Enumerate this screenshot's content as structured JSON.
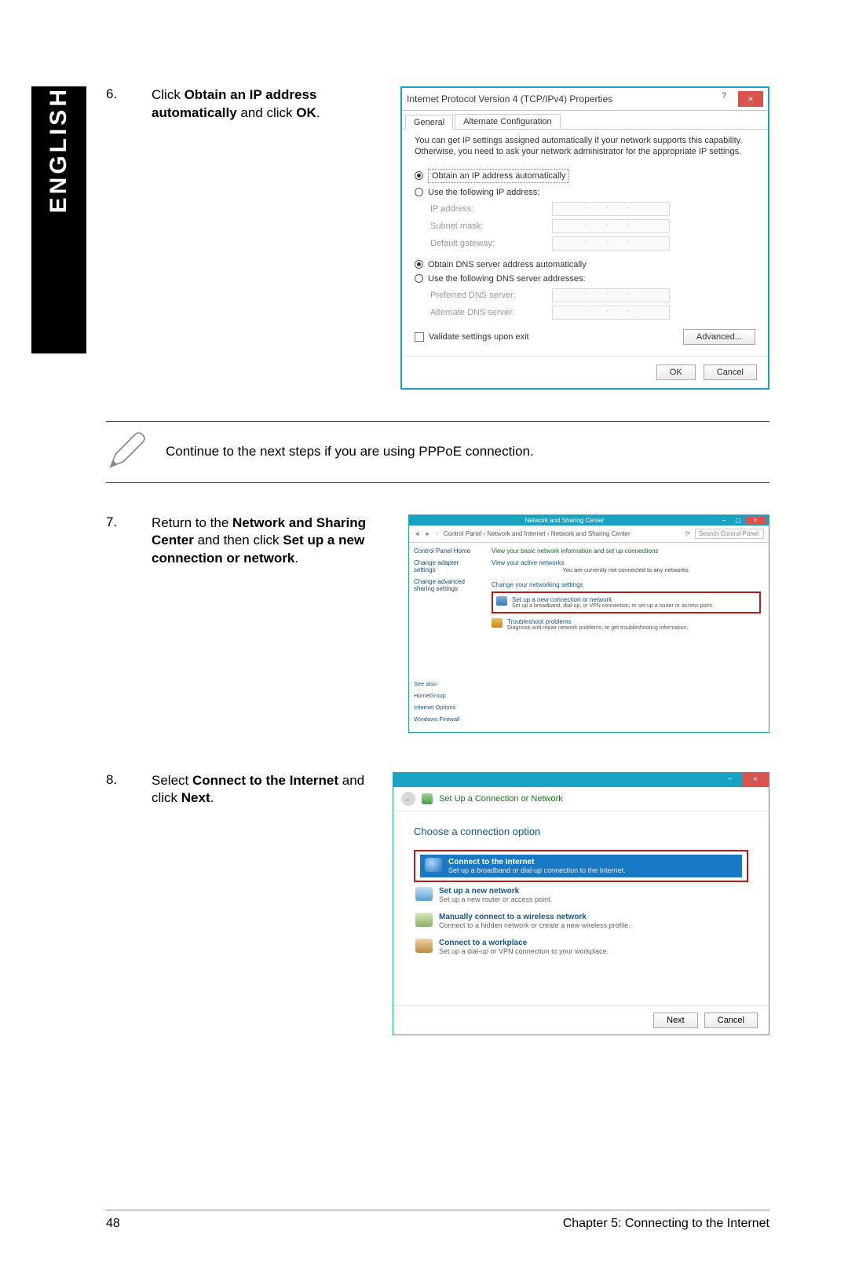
{
  "language_tab": "ENGLISH",
  "step6": {
    "num": "6.",
    "text_parts": [
      "Click ",
      "Obtain an IP address automatically",
      " and click ",
      "OK",
      "."
    ]
  },
  "dialog1": {
    "title": "Internet Protocol Version 4 (TCP/IPv4) Properties",
    "help": "?",
    "close": "×",
    "tab_general": "General",
    "tab_alt": "Alternate Configuration",
    "info": "You can get IP settings assigned automatically if your network supports this capability. Otherwise, you need to ask your network administrator for the appropriate IP settings.",
    "opt_auto_ip": "Obtain an IP address automatically",
    "opt_use_ip": "Use the following IP address:",
    "lbl_ip": "IP address:",
    "lbl_mask": "Subnet mask:",
    "lbl_gw": "Default gateway:",
    "opt_auto_dns": "Obtain DNS server address automatically",
    "opt_use_dns": "Use the following DNS server addresses:",
    "lbl_pref": "Preferred DNS server:",
    "lbl_alt": "Alternate DNS server:",
    "chk_validate": "Validate settings upon exit",
    "btn_adv": "Advanced...",
    "btn_ok": "OK",
    "btn_cancel": "Cancel",
    "ip_dots": "·   ·   ·"
  },
  "note": "Continue to the next steps if you are using PPPoE connection.",
  "step7": {
    "num": "7.",
    "text_parts": [
      "Return to the ",
      "Network and Sharing Center",
      " and then click ",
      "Set up a new connection or network",
      "."
    ]
  },
  "dialog2": {
    "title": "Network and Sharing Center",
    "close": "×",
    "breadcrumb": "Control Panel  ›  Network and Internet  ›  Network and Sharing Center",
    "search_placeholder": "Search Control Panel",
    "side_home": "Control Panel Home",
    "side_adapter": "Change adapter settings",
    "side_sharing": "Change advanced sharing settings",
    "main_head": "View your basic network information and set up connections",
    "main_active": "View your active networks",
    "main_active_note": "You are currently not connected to any networks.",
    "main_change": "Change your networking settings",
    "task1_title": "Set up a new connection or network",
    "task1_sub": "Set up a broadband, dial-up, or VPN connection; or set up a router or access point.",
    "task2_title": "Troubleshoot problems",
    "task2_sub": "Diagnose and repair network problems, or get troubleshooting information.",
    "seealso": "See also",
    "seealso1": "HomeGroup",
    "seealso2": "Internet Options",
    "seealso3": "Windows Firewall"
  },
  "step8": {
    "num": "8.",
    "text_parts": [
      "Select ",
      "Connect to the Internet",
      " and click ",
      "Next",
      "."
    ]
  },
  "dialog3": {
    "min": "−",
    "close": "×",
    "subtitle": "Set Up a Connection or Network",
    "choose": "Choose a connection option",
    "opt1_title": "Connect to the Internet",
    "opt1_sub": "Set up a broadband or dial-up connection to the Internet.",
    "opt2_title": "Set up a new network",
    "opt2_sub": "Set up a new router or access point.",
    "opt3_title": "Manually connect to a wireless network",
    "opt3_sub": "Connect to a hidden network or create a new wireless profile.",
    "opt4_title": "Connect to a workplace",
    "opt4_sub": "Set up a dial-up or VPN connection to your workplace.",
    "btn_next": "Next",
    "btn_cancel": "Cancel"
  },
  "footer": {
    "page": "48",
    "chapter": "Chapter 5: Connecting to the Internet"
  }
}
